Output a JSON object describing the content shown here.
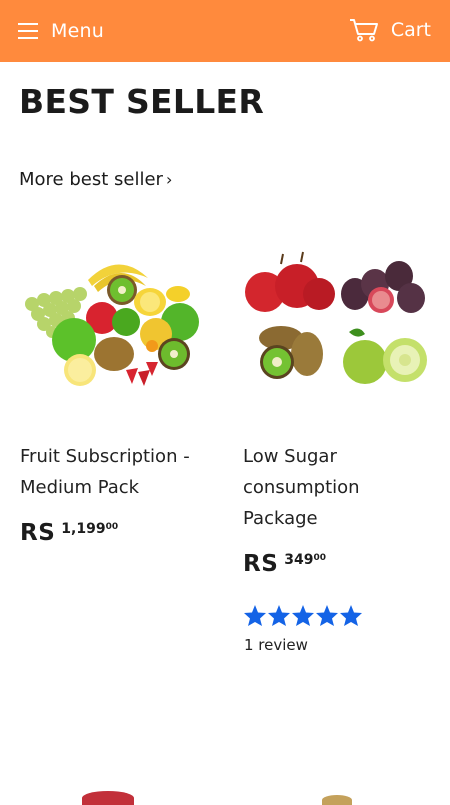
{
  "header": {
    "menu_label": "Menu",
    "cart_label": "Cart",
    "menu_icon": "hamburger-icon",
    "cart_icon": "cart-icon",
    "bar_color": "#ff8a3d"
  },
  "section": {
    "title": "BEST SELLER",
    "more_link": "More best seller",
    "more_chevron": "›"
  },
  "products": [
    {
      "title": "Fruit Subscription - Medium Pack",
      "currency": "RS",
      "price_main": "1,199",
      "price_cents": "00",
      "image": "mixed-fruit-pile"
    },
    {
      "title": "Low Sugar consumption Package",
      "currency": "RS",
      "price_main": "349",
      "price_cents": "00",
      "rating": 5,
      "reviews": "1 review",
      "image": "apples-figs-kiwi-guava-grid"
    }
  ],
  "colors": {
    "star": "#1463e6",
    "accent": "#ff8a3d"
  }
}
